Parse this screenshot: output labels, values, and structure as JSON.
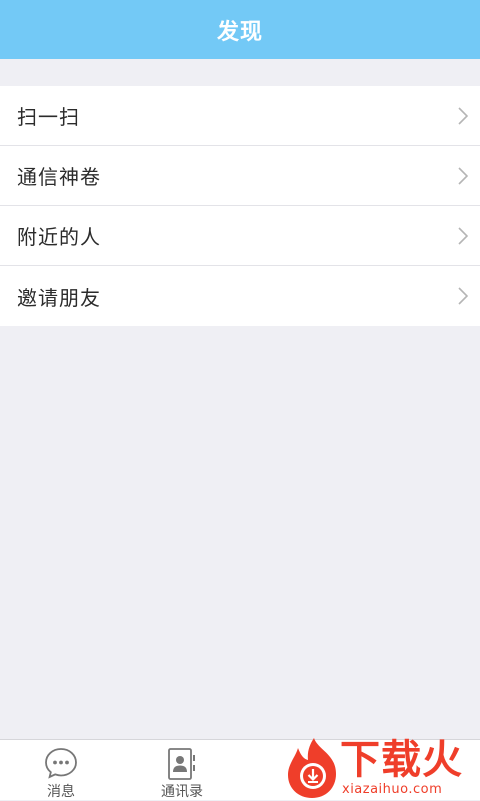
{
  "header": {
    "title": "发现"
  },
  "menu": {
    "items": [
      {
        "label": "扫一扫"
      },
      {
        "label": "通信神卷"
      },
      {
        "label": "附近的人"
      },
      {
        "label": "邀请朋友"
      }
    ]
  },
  "tabbar": {
    "tabs": [
      {
        "label": "消息",
        "icon": "chat-bubble-icon"
      },
      {
        "label": "通讯录",
        "icon": "contacts-book-icon"
      }
    ]
  },
  "watermark": {
    "text": "下载火",
    "url": "xiazaihuo.com"
  },
  "colors": {
    "header_bg": "#73c9f6",
    "page_bg": "#efeff4",
    "watermark": "#ef3e2a"
  }
}
